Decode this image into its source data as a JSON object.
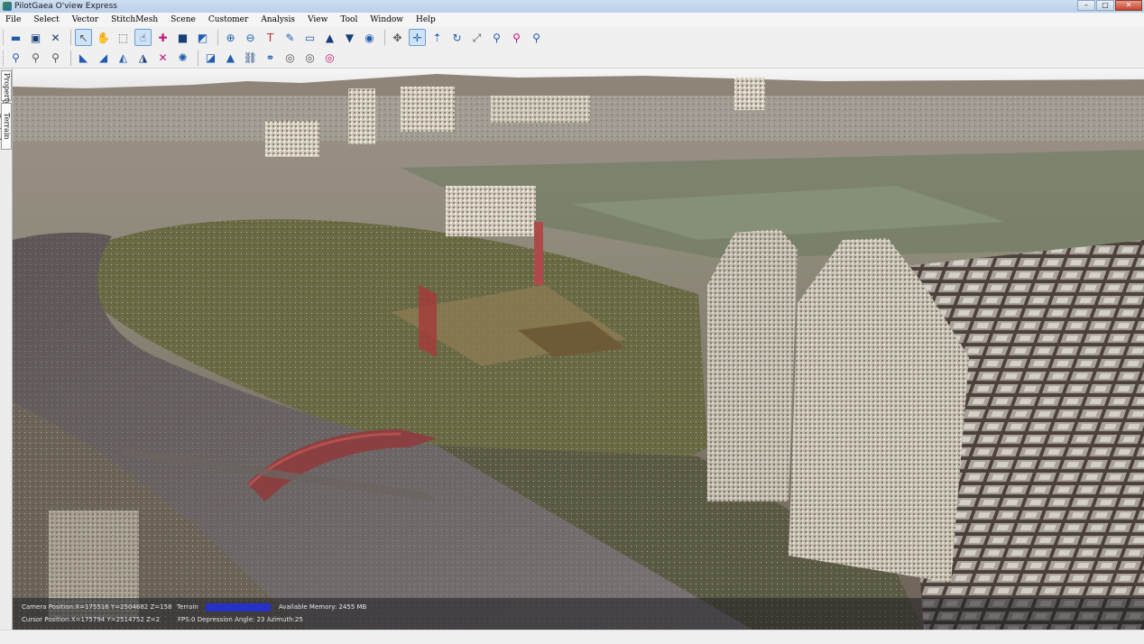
{
  "window": {
    "title": "PilotGaea O'view Express",
    "minimize": "–",
    "maximize": "□",
    "close": "✕"
  },
  "menu": [
    "File",
    "Select",
    "Vector",
    "StitchMesh",
    "Scene",
    "Customer",
    "Analysis",
    "View",
    "Tool",
    "Window",
    "Help"
  ],
  "toolbar1": [
    {
      "name": "open-folder-icon",
      "glyph": "▬",
      "color": "c-blue"
    },
    {
      "name": "save-icon",
      "glyph": "▣",
      "color": "c-dblue"
    },
    {
      "name": "close-doc-icon",
      "glyph": "✕",
      "color": "c-dblue"
    },
    {
      "sep": true
    },
    {
      "name": "select-pointer-icon",
      "glyph": "↖",
      "color": "c-gray",
      "active": true
    },
    {
      "name": "pan-icon",
      "glyph": "✋",
      "color": "c-blue"
    },
    {
      "name": "zoom-box-icon",
      "glyph": "⬚",
      "color": "c-gray"
    },
    {
      "name": "hand-select-icon",
      "glyph": "☝",
      "color": "c-dblue",
      "active": true
    },
    {
      "name": "add-point-icon",
      "glyph": "✚",
      "color": "c-mag"
    },
    {
      "name": "rectangle-icon",
      "glyph": "■",
      "color": "c-dblue"
    },
    {
      "name": "layer-select-icon",
      "glyph": "◩",
      "color": "c-blue"
    },
    {
      "sep": true
    },
    {
      "name": "add-layer-icon",
      "glyph": "⊕",
      "color": "c-blue"
    },
    {
      "name": "remove-layer-icon",
      "glyph": "⊖",
      "color": "c-blue"
    },
    {
      "name": "text-layer-icon",
      "glyph": "T",
      "color": "c-red"
    },
    {
      "name": "edit-terrain-icon",
      "glyph": "✎",
      "color": "c-blue"
    },
    {
      "name": "flatten-icon",
      "glyph": "▭",
      "color": "c-blue"
    },
    {
      "name": "terrain-raise-icon",
      "glyph": "▲",
      "color": "c-dblue"
    },
    {
      "name": "terrain-lower-icon",
      "glyph": "▼",
      "color": "c-dblue"
    },
    {
      "name": "globe-icon",
      "glyph": "◉",
      "color": "c-blue"
    },
    {
      "sep": true
    },
    {
      "name": "move-tool-icon",
      "glyph": "✥",
      "color": "c-gray"
    },
    {
      "name": "move-axis-icon",
      "glyph": "✛",
      "color": "c-blue",
      "active": true
    },
    {
      "name": "move-up-icon",
      "glyph": "⇡",
      "color": "c-blue"
    },
    {
      "name": "rotate-icon",
      "glyph": "↻",
      "color": "c-blue"
    },
    {
      "name": "scale-icon",
      "glyph": "⤢",
      "color": "c-gray"
    },
    {
      "name": "pin-icon",
      "glyph": "⚲",
      "color": "c-blue"
    },
    {
      "name": "pin-red-icon",
      "glyph": "⚲",
      "color": "c-mag"
    },
    {
      "name": "pin-link-icon",
      "glyph": "⚲",
      "color": "c-blue"
    }
  ],
  "toolbar2": [
    {
      "name": "measure-distance-icon",
      "glyph": "⚲",
      "color": "c-blue"
    },
    {
      "name": "measure-height-icon",
      "glyph": "⚲",
      "color": "c-gray"
    },
    {
      "name": "measure-area-icon",
      "glyph": "⚲",
      "color": "c-gray"
    },
    {
      "sep": true
    },
    {
      "name": "profile-icon",
      "glyph": "◣",
      "color": "c-blue"
    },
    {
      "name": "slope-icon",
      "glyph": "◢",
      "color": "c-blue"
    },
    {
      "name": "cut-fill-icon",
      "glyph": "◭",
      "color": "c-blue"
    },
    {
      "name": "flood-icon",
      "glyph": "◮",
      "color": "c-dblue"
    },
    {
      "name": "clear-analysis-icon",
      "glyph": "✕",
      "color": "c-mag"
    },
    {
      "name": "settings-icon",
      "glyph": "✺",
      "color": "c-blue"
    },
    {
      "sep": true
    },
    {
      "name": "viewshed-icon",
      "glyph": "◪",
      "color": "c-blue"
    },
    {
      "name": "triangle-icon",
      "glyph": "▲",
      "color": "c-blue"
    },
    {
      "name": "link-icon",
      "glyph": "⛓",
      "color": "c-dblue"
    },
    {
      "name": "chain-icon",
      "glyph": "⚭",
      "color": "c-blue"
    },
    {
      "name": "eye-icon",
      "glyph": "◎",
      "color": "c-gray"
    },
    {
      "name": "eye-multi-icon",
      "glyph": "◎",
      "color": "c-gray"
    },
    {
      "name": "eye-clear-icon",
      "glyph": "◎",
      "color": "c-mag"
    }
  ],
  "sidetabs": {
    "property": "Property",
    "terrain": "Terrain Control"
  },
  "status": {
    "camera": "Camera Position:X=175516 Y=2504682 Z=158",
    "cursor": "Cursor Position:X=175794 Y=2514752 Z=2",
    "terrain_label": "Terrain",
    "memory": "Available Memory: 2455 MB",
    "fps": "FPS:0  Depression Angle: 23  Azimuth:25"
  }
}
